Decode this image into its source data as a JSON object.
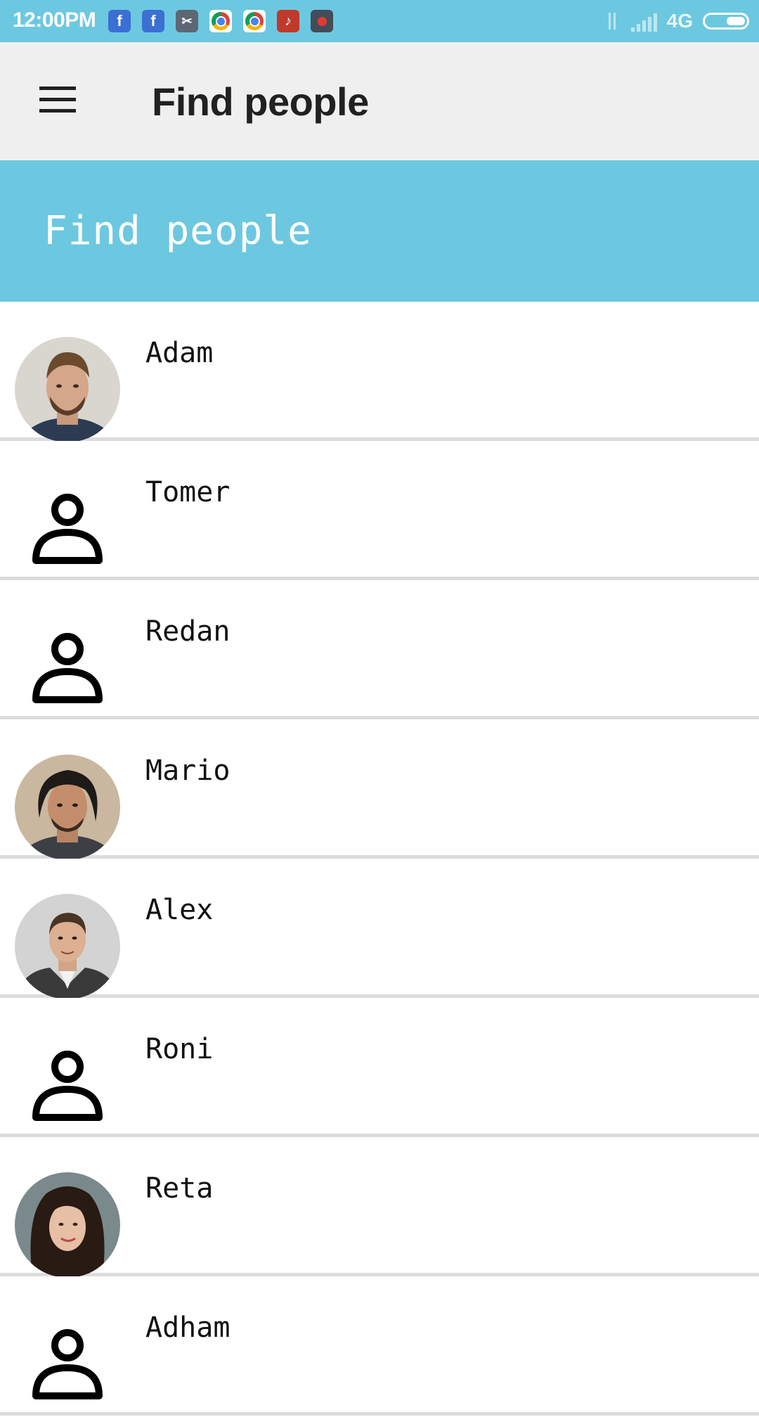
{
  "status_bar": {
    "time": "12:00PM",
    "notification_icons": [
      "facebook-icon",
      "facebook-icon",
      "scissors-app-icon",
      "chrome-icon",
      "chrome-icon",
      "tiktok-icon",
      "screen-recorder-icon"
    ],
    "network_type": "4G",
    "color": "#6cc8e0"
  },
  "app_bar": {
    "title": "Find people",
    "menu_icon": "hamburger-menu-icon"
  },
  "banner": {
    "title": "Find people",
    "color": "#6cc8e0"
  },
  "people": [
    {
      "name": "Adam",
      "avatar": "photo"
    },
    {
      "name": "Tomer",
      "avatar": "placeholder"
    },
    {
      "name": "Redan",
      "avatar": "placeholder"
    },
    {
      "name": "Mario",
      "avatar": "photo"
    },
    {
      "name": "Alex",
      "avatar": "photo"
    },
    {
      "name": "Roni",
      "avatar": "placeholder"
    },
    {
      "name": "Reta",
      "avatar": "photo"
    },
    {
      "name": "Adham",
      "avatar": "placeholder"
    }
  ]
}
